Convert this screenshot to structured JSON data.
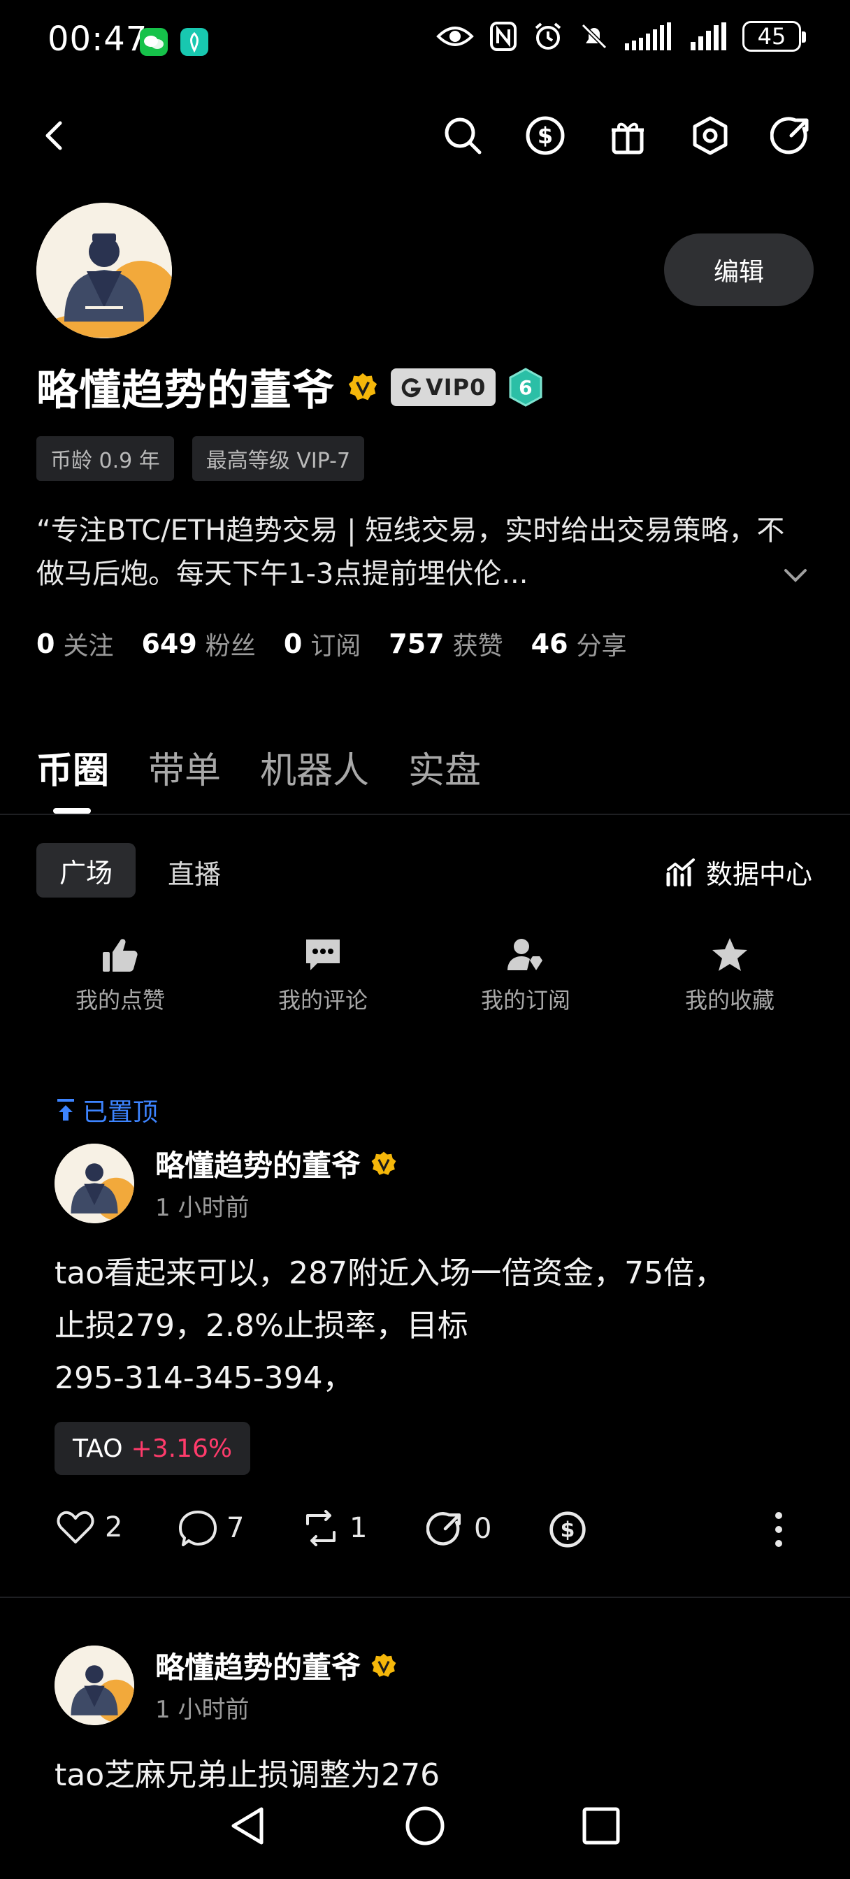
{
  "status_bar": {
    "time": "00:47",
    "battery": "45"
  },
  "profile": {
    "name": "略懂趋势的董爷",
    "vip_label": "VIP0",
    "level": "6",
    "edit_label": "编辑",
    "tags": [
      "币龄 0.9 年",
      "最高等级 VIP-7"
    ],
    "bio": "“专注BTC/ETH趋势交易 | 短线交易，实时给出交易策略，不做马后炮。每天下午1-3点提前埋伏伦...",
    "stats": [
      {
        "value": "0",
        "label": "关注"
      },
      {
        "value": "649",
        "label": "粉丝"
      },
      {
        "value": "0",
        "label": "订阅"
      },
      {
        "value": "757",
        "label": "获赞"
      },
      {
        "value": "46",
        "label": "分享"
      }
    ]
  },
  "tabs": [
    "币圈",
    "带单",
    "机器人",
    "实盘"
  ],
  "subtabs": {
    "active": "广场",
    "other": "直播",
    "data_center": "数据中心"
  },
  "quick_actions": [
    "我的点赞",
    "我的评论",
    "我的订阅",
    "我的收藏"
  ],
  "posts": [
    {
      "pinned_label": "已置顶",
      "author": "略懂趋势的董爷",
      "time": "1 小时前",
      "body_lines": [
        "tao看起来可以，287附近入场一倍资金，75倍，",
        "止损279，2.8%止损率，目标",
        "295-314-345-394，"
      ],
      "coin": {
        "symbol": "TAO",
        "change": "+3.16%"
      },
      "likes": "2",
      "comments": "7",
      "reposts": "1",
      "shares": "0"
    },
    {
      "author": "略懂趋势的董爷",
      "time": "1 小时前",
      "body_lines": [
        "tao芝麻兄弟止损调整为276"
      ]
    }
  ],
  "colors": {
    "background": "#000000",
    "accent_blue": "#3d84ff",
    "gain_red": "#ff3b6b",
    "verified_gold": "#f5b70a",
    "level_teal": "#2bbfa6"
  }
}
